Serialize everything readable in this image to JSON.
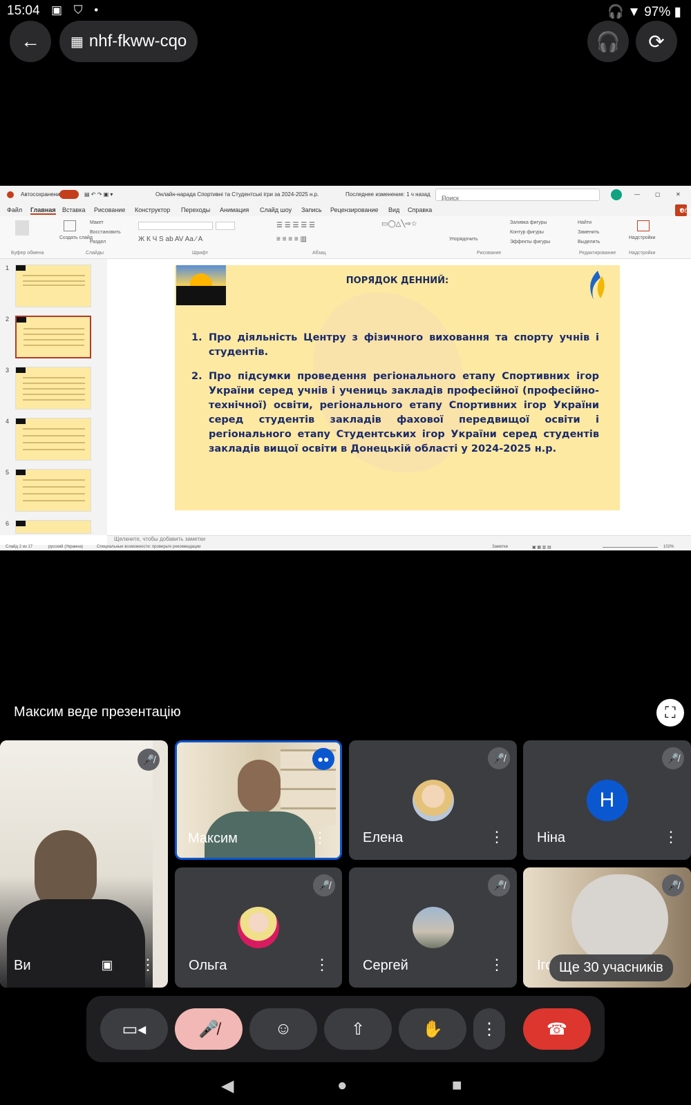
{
  "status_bar": {
    "time": "15:04",
    "battery": "97%"
  },
  "meet": {
    "code": "nhf-fkww-cqo",
    "presenting_label": "Максим веде презентацію",
    "overflow_label": "Ще 30 учасників",
    "participants": [
      {
        "name": "Ви"
      },
      {
        "name": "Максим"
      },
      {
        "name": "Елена"
      },
      {
        "name": "Ніна",
        "initial": "Н",
        "color": "#0b57d0"
      },
      {
        "name": "Ольга"
      },
      {
        "name": "Сергей"
      },
      {
        "name": "Ігор"
      }
    ]
  },
  "powerpoint": {
    "title_bar": {
      "autosave": "Автосохранение",
      "doc_title": "Онлайн-нарада Спортивні та Студентські ігри за 2024-2025 н.р.",
      "last_change": "Последнее изменение: 1 ч назад",
      "search_placeholder": "Поиск"
    },
    "menu": [
      "Файл",
      "Главная",
      "Вставка",
      "Рисование",
      "Конструктор",
      "Переходы",
      "Анимация",
      "Слайд шоу",
      "Запись",
      "Рецензирование",
      "Вид",
      "Справка"
    ],
    "share_label": "Общий доступ",
    "ribbon": {
      "groups": [
        "Буфер обмена",
        "Слайды",
        "Шрифт",
        "Абзац",
        "Рисование",
        "Редактирование",
        "Надстройки"
      ],
      "items": [
        "Макет",
        "Восстановить",
        "Раздел",
        "Создать слайд",
        "Упорядочить",
        "Найти",
        "Заменить",
        "Выделить",
        "Надстройки",
        "Заливка фигуры",
        "Контур фигуры",
        "Эффекты фигуры"
      ]
    },
    "thumb_numbers": [
      "1",
      "2",
      "3",
      "4",
      "5",
      "6"
    ],
    "slide": {
      "title": "ПОРЯДОК ДЕННИЙ:",
      "items": [
        {
          "num": "1.",
          "text": "Про діяльність Центру з фізичного виховання та спорту учнів і студентів."
        },
        {
          "num": "2.",
          "text": "Про підсумки проведення регіонального етапу Спортивних ігор України серед учнів і учениць закладів професійної (професійно-технічної) освіти, регіонального етапу Спортивних ігор України серед студентів закладів фахової передвищої освіти і регіонального етапу Студентських ігор України серед студентів закладів вищої освіти в Донецькій області у 2024-2025 н.р."
        }
      ]
    },
    "notes_placeholder": "Щелкните, чтобы добавить заметки",
    "status": {
      "slide_info": "Слайд 2 из 17",
      "language": "русский (Украина)",
      "accessibility": "Специальные возможности: проверьте рекомендации",
      "notes": "Заметки",
      "zoom": "102%"
    }
  }
}
